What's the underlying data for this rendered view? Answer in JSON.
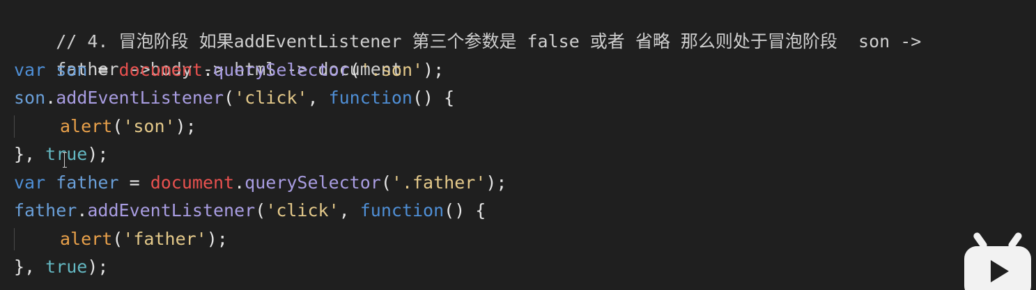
{
  "code": {
    "comment_line_1": "// 4. 冒泡阶段 如果addEventListener 第三个参数是 false 或者 省略 那么则处于冒泡阶段  son ->",
    "comment_line_2": "father ->body -> html -> document",
    "line3": {
      "kw_var": "var",
      "name": "son",
      "eq": " = ",
      "obj": "document",
      "dot": ".",
      "method": "querySelector",
      "open": "(",
      "str": "'.son'",
      "close": ");"
    },
    "line4": {
      "name": "son",
      "dot": ".",
      "method": "addEventListener",
      "open": "(",
      "str": "'click'",
      "comma": ", ",
      "kw_function": "function",
      "rest": "() {"
    },
    "line5": {
      "func": "alert",
      "open": "(",
      "str": "'son'",
      "close": ");"
    },
    "line6": {
      "brace": "}, ",
      "bool": "true",
      "close": ");"
    },
    "line7": {
      "kw_var": "var",
      "name": "father",
      "eq": " = ",
      "obj": "document",
      "dot": ".",
      "method": "querySelector",
      "open": "(",
      "str": "'.father'",
      "close": ");"
    },
    "line8": {
      "name": "father",
      "dot": ".",
      "method": "addEventListener",
      "open": "(",
      "str": "'click'",
      "comma": ", ",
      "kw_function": "function",
      "rest": "() {"
    },
    "line9": {
      "func": "alert",
      "open": "(",
      "str": "'father'",
      "close": ");"
    },
    "line10": {
      "brace": "}, ",
      "bool": "true",
      "close": ");"
    }
  },
  "colors": {
    "background": "#1f1f1f",
    "keyword": "#4f8fd6",
    "variable": "#6a9fd8",
    "object": "#e8514f",
    "method": "#a99de2",
    "string": "#e4c98a",
    "function_call": "#e8a04a",
    "boolean": "#64b8c2"
  },
  "icons": {
    "cursor": "text-cursor-icon",
    "logo": "bilibili-logo-icon"
  }
}
